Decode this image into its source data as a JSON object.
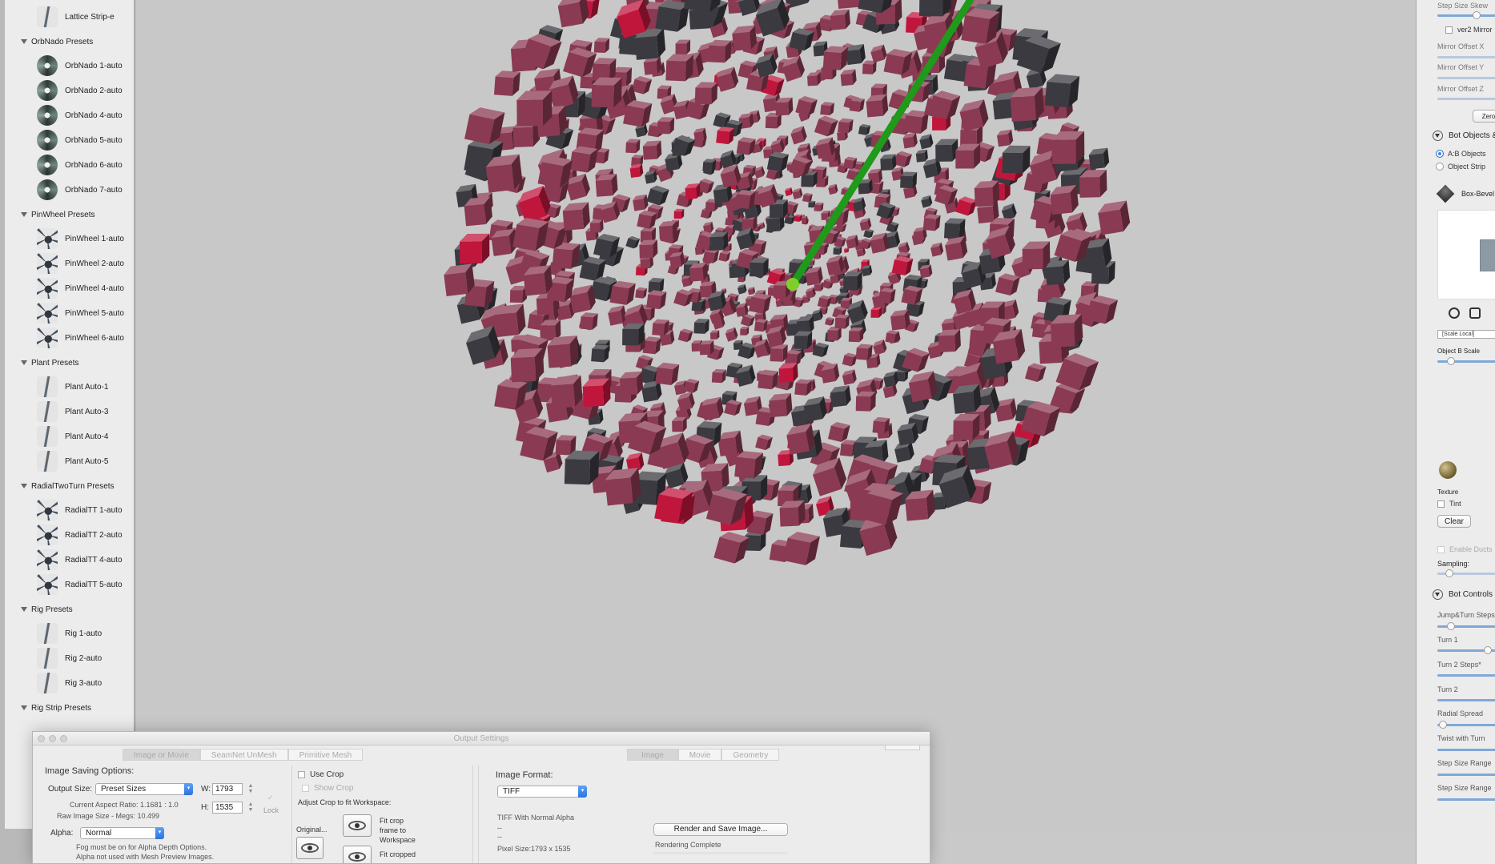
{
  "sidebar": {
    "top_item": "Lattice Strip-e",
    "groups": [
      {
        "title": "OrbNado Presets",
        "items": [
          "OrbNado 1-auto",
          "OrbNado 2-auto",
          "OrbNado 4-auto",
          "OrbNado 5-auto",
          "OrbNado 6-auto",
          "OrbNado 7-auto"
        ]
      },
      {
        "title": "PinWheel Presets",
        "items": [
          "PinWheel 1-auto",
          "PinWheel 2-auto",
          "PinWheel 4-auto",
          "PinWheel 5-auto",
          "PinWheel 6-auto"
        ]
      },
      {
        "title": "Plant Presets",
        "items": [
          "Plant Auto-1",
          "Plant Auto-3",
          "Plant Auto-4",
          "Plant Auto-5"
        ]
      },
      {
        "title": "RadialTwoTurn Presets",
        "items": [
          "RadialTT 1-auto",
          "RadialTT 2-auto",
          "RadialTT 4-auto",
          "RadialTT 5-auto"
        ]
      },
      {
        "title": "Rig Presets",
        "items": [
          "Rig 1-auto",
          "Rig 2-auto",
          "Rig 3-auto"
        ]
      },
      {
        "title": "Rig Strip Presets",
        "items": []
      }
    ]
  },
  "right_panel": {
    "step_size_skew": "Step Size Skew",
    "ver2_mirror": "ver2 Mirror",
    "mirror_offset_x": "Mirror Offset X",
    "mirror_offset_y": "Mirror Offset Y",
    "mirror_offset_z": "Mirror Offset Z",
    "zero_button": "Zero",
    "bot_objects_section": "Bot Objects &",
    "ab_objects": "A:B Objects",
    "object_strip": "Object Strip",
    "box_bevel": "Box-Bevel",
    "scale_local": "[Scale Local]",
    "object_b_scale": "Object B Scale",
    "texture": "Texture",
    "tint": "Tint",
    "clear_button": "Clear",
    "enable_ducts": "Enable Ducts",
    "sampling": "Sampling:",
    "bot_controls_section": "Bot Controls",
    "jump_turn_steps": "Jump&Turn Steps",
    "turn_1": "Turn 1",
    "turn_2_steps": "Turn 2 Steps*",
    "turn_2": "Turn 2",
    "radial_spread": "Radial Spread",
    "twist_with_turn": "Twist with Turn",
    "step_size_range_1": "Step Size Range",
    "step_size_range_2": "Step Size Range"
  },
  "dialog": {
    "title": "Output Settings",
    "left_tabs": [
      "Image or Movie",
      "SeamNet UnMesh",
      "Primitive Mesh"
    ],
    "right_tabs": [
      "Image",
      "Movie",
      "Geometry"
    ],
    "image_saving_options": "Image Saving Options:",
    "output_size_label": "Output Size:",
    "output_size_value": "Preset Sizes",
    "w_label": "W:",
    "w_value": "1793",
    "h_label": "H:",
    "h_value": "1535",
    "lock_label": "Lock",
    "aspect_ratio": "Current Aspect Ratio: 1.1681 : 1.0",
    "raw_image_size": "Raw Image Size - Megs: 10.499",
    "alpha_label": "Alpha:",
    "alpha_value": "Normal",
    "fog_note_1": "Fog must be on for Alpha Depth Options.",
    "fog_note_2": "Alpha not used with Mesh Preview Images.",
    "use_crop": "Use Crop",
    "show_crop": "Show Crop",
    "adjust_crop": "Adjust Crop to fit Workspace:",
    "original_label": "Original...",
    "fit_crop_frame": [
      "Fit crop",
      "frame to",
      "Workspace"
    ],
    "fit_cropped": "Fit cropped",
    "image_format_label": "Image Format:",
    "image_format_value": "TIFF",
    "format_description": "TIFF With Normal Alpha",
    "dash_1": "--",
    "dash_2": "--",
    "pixel_size": "Pixel Size:1793 x 1535",
    "render_button": "Render and Save Image...",
    "status": "Rendering Complete"
  },
  "scene": {
    "background": "#c8c8c8",
    "cube_color": "#8a3a52",
    "dark_cube_color": "#3a3a40",
    "highlight_color": "#c0163c",
    "axis_color": "#1f9a1a"
  }
}
